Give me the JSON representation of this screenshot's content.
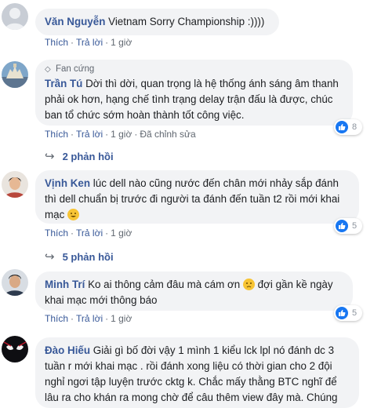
{
  "actions": {
    "like": "Thích",
    "reply": "Trả lời",
    "edited": "Đã chỉnh sửa"
  },
  "comments": [
    {
      "name": "Văn Nguyễn",
      "text": "Vietnam Sorry Championship :))))",
      "time": "1 giờ"
    },
    {
      "badge": "Fan cứng",
      "name": "Trần Tú",
      "text": "Dời thì dời, quan trọng là hệ thống ánh sáng âm thanh phải ok hơn, hạng chế tình trạng delay trận đấu là được, chúc ban tổ chức sớm hoàn thành tốt công việc.",
      "time": "1 giờ",
      "reactions": "8",
      "replies": "2 phản hồi"
    },
    {
      "name": "Vịnh Ken",
      "text": "lúc dell nào cũng nước đến chân mới nhảy sắp đánh thì dell chuẩn bị trước đi người ta đánh đến tuần t2 rồi mới khai mạc",
      "time": "1 giờ",
      "reactions": "5",
      "replies": "5 phản hồi"
    },
    {
      "name": "Minh Trí",
      "text": "Ko ai thông cảm đâu mà cám ơn",
      "text2": "đợi gần kề ngày khai mạc mới thông báo",
      "time": "1 giờ",
      "reactions": "5"
    },
    {
      "name": "Đào Hiếu",
      "text": "Giải gì bố đời vậy 1 mình 1 kiểu lck lpl nó đánh dc 3 tuần r mới khai mạc . rồi đánh xong liệu có thời gian cho 2 đội nghỉ ngơi tập luyện trước cktg k. Chắc mấy thằng BTC nghĩ để lâu ra cho khán ra mong chờ để câu thêm view đây mà. Chúng"
    }
  ]
}
